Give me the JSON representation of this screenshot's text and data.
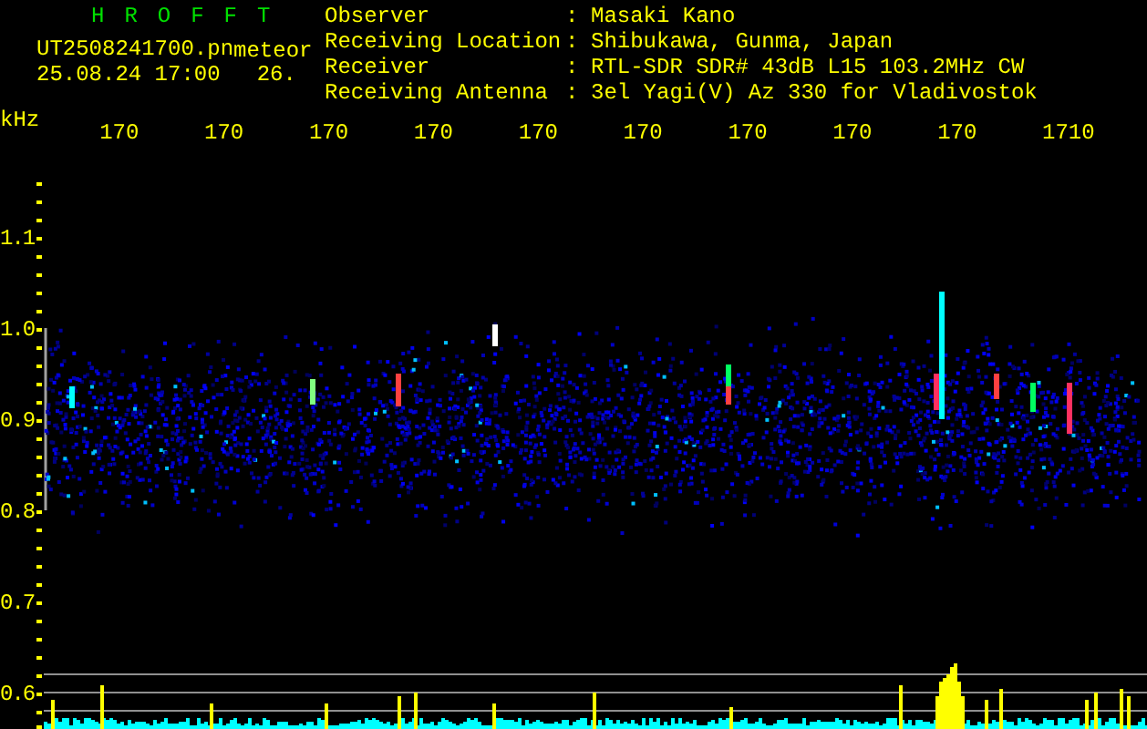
{
  "header": {
    "title": "HROFFT",
    "file": "UT2508241700.pn",
    "mode": "meteor",
    "datetime": "25.08.24 17:00",
    "count": "26."
  },
  "info": [
    {
      "label": "Observer",
      "sep": ":",
      "value": "Masaki Kano"
    },
    {
      "label": "Receiving Location",
      "sep": ":",
      "value": "Shibukawa, Gunma, Japan"
    },
    {
      "label": "Receiver",
      "sep": ":",
      "value": "RTL-SDR SDR# 43dB L15 103.2MHz CW"
    },
    {
      "label": "Receiving Antenna",
      "sep": ":",
      "value": "3el Yagi(V) Az 330 for Vladivostok"
    }
  ],
  "x_axis": {
    "unit": "kHz",
    "ticks": [
      "170",
      "170",
      "170",
      "170",
      "170",
      "170",
      "170",
      "170",
      "170",
      "1710"
    ]
  },
  "y_axis": {
    "ticks": [
      "1.1",
      "1.0",
      "0.9",
      "0.8",
      "0.7",
      "0.6"
    ]
  }
}
